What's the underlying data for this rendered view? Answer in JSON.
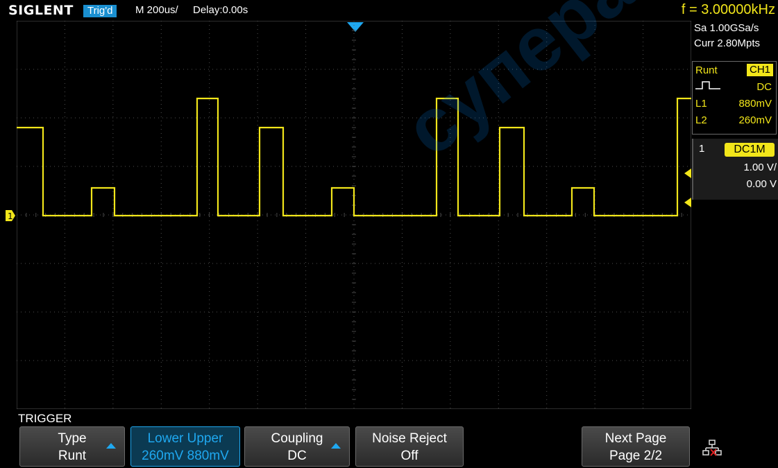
{
  "header": {
    "brand": "SIGLENT",
    "trigger_status": "Trig'd",
    "timebase": "M 200us/",
    "delay": "Delay:0.00s",
    "frequency": "f = 3.00000kHz"
  },
  "acquisition": {
    "sample_rate": "Sa 1.00GSa/s",
    "memory": "Curr 2.80Mpts"
  },
  "trigger_info": {
    "type": "Runt",
    "source": "CH1",
    "coupling": "DC",
    "level1_label": "L1",
    "level1": "880mV",
    "level2_label": "L2",
    "level2": "260mV"
  },
  "channel1": {
    "number": "1",
    "coupling_impedance": "DC1M",
    "scale": "1.00 V/",
    "offset": "0.00 V",
    "marker": "1"
  },
  "menu": {
    "title": "TRIGGER",
    "softkeys": [
      {
        "line1": "Type",
        "line2": "Runt"
      },
      {
        "line1": "Lower  Upper",
        "line2": "260mV  880mV"
      },
      {
        "line1": "Coupling",
        "line2": "DC"
      },
      {
        "line1": "Noise Reject",
        "line2": "Off"
      },
      {
        "line1": "Next Page",
        "line2": "Page 2/2"
      }
    ]
  },
  "watermark": "суперайс",
  "colors": {
    "trace": "#f2e61a",
    "accent": "#1fa8f0",
    "grid": "#5a5a5a"
  }
}
